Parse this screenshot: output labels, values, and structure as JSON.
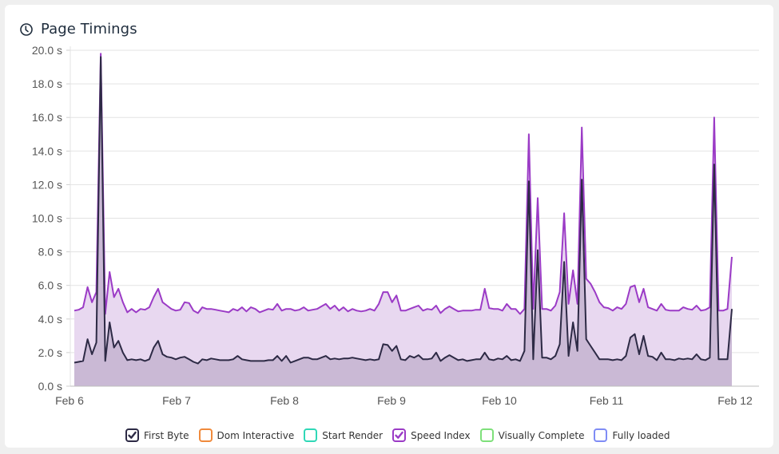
{
  "panel": {
    "title": "Page Timings",
    "icon": "clock-icon"
  },
  "legend": [
    {
      "label": "First Byte",
      "color": "#2d2a45",
      "checked": true
    },
    {
      "label": "Dom Interactive",
      "color": "#f08a3c",
      "checked": false
    },
    {
      "label": "Start Render",
      "color": "#2fd8b7",
      "checked": false
    },
    {
      "label": "Speed Index",
      "color": "#9b3bc6",
      "checked": true
    },
    {
      "label": "Visually Complete",
      "color": "#7ee07a",
      "checked": false
    },
    {
      "label": "Fully loaded",
      "color": "#7f8cf5",
      "checked": false
    }
  ],
  "chart_data": {
    "type": "area",
    "title": "Page Timings",
    "xlabel": "",
    "ylabel": "",
    "ylim": [
      0,
      20
    ],
    "yticks": [
      "0.0 s",
      "2.0 s",
      "4.0 s",
      "6.0 s",
      "8.0 s",
      "10.0 s",
      "12.0 s",
      "14.0 s",
      "16.0 s",
      "18.0 s",
      "20.0 s"
    ],
    "xticks": [
      "Feb 6",
      "Feb 7",
      "Feb 8",
      "Feb 9",
      "Feb 10",
      "Feb 11",
      "Feb 12"
    ],
    "xrange_days": [
      0,
      6
    ],
    "x_start_day": 0.045,
    "x_end_day": 6.0,
    "grid": true,
    "legend_position": "bottom",
    "series": [
      {
        "name": "Speed Index",
        "color": "#9b3bc6",
        "fill": "#e8d8f0",
        "values": [
          4.5,
          4.55,
          4.7,
          5.9,
          5.0,
          5.6,
          19.8,
          4.3,
          6.8,
          5.3,
          5.8,
          5.0,
          4.4,
          4.6,
          4.4,
          4.6,
          4.55,
          4.7,
          5.3,
          5.8,
          5.0,
          4.8,
          4.6,
          4.5,
          4.55,
          5.0,
          4.95,
          4.5,
          4.35,
          4.7,
          4.6,
          4.6,
          4.55,
          4.5,
          4.45,
          4.4,
          4.6,
          4.5,
          4.7,
          4.45,
          4.7,
          4.6,
          4.4,
          4.5,
          4.6,
          4.55,
          4.9,
          4.5,
          4.6,
          4.6,
          4.5,
          4.55,
          4.7,
          4.5,
          4.55,
          4.6,
          4.75,
          4.9,
          4.6,
          4.8,
          4.5,
          4.7,
          4.45,
          4.6,
          4.5,
          4.45,
          4.5,
          4.6,
          4.5,
          4.9,
          5.6,
          5.6,
          5.0,
          5.4,
          4.5,
          4.5,
          4.6,
          4.7,
          4.8,
          4.5,
          4.6,
          4.55,
          4.8,
          4.35,
          4.6,
          4.75,
          4.6,
          4.45,
          4.5,
          4.5,
          4.5,
          4.55,
          4.55,
          5.8,
          4.65,
          4.6,
          4.6,
          4.5,
          4.9,
          4.6,
          4.6,
          4.3,
          4.6,
          15.0,
          4.6,
          11.2,
          4.6,
          4.6,
          4.5,
          4.8,
          5.6,
          10.3,
          4.9,
          6.9,
          4.9,
          15.4,
          6.4,
          6.1,
          5.6,
          5.0,
          4.7,
          4.65,
          4.5,
          4.7,
          4.6,
          4.9,
          5.9,
          6.0,
          5.0,
          5.8,
          4.7,
          4.6,
          4.5,
          4.9,
          4.55,
          4.5,
          4.5,
          4.5,
          4.7,
          4.6,
          4.55,
          4.8,
          4.5,
          4.55,
          4.7,
          16.0,
          4.5,
          4.5,
          4.6,
          7.7
        ]
      },
      {
        "name": "First Byte",
        "color": "#2d2a45",
        "fill": "#c6b6d2",
        "values": [
          1.4,
          1.45,
          1.5,
          2.8,
          1.9,
          2.6,
          19.6,
          1.5,
          3.8,
          2.3,
          2.7,
          2.0,
          1.55,
          1.6,
          1.55,
          1.6,
          1.5,
          1.6,
          2.3,
          2.7,
          1.9,
          1.75,
          1.7,
          1.6,
          1.7,
          1.75,
          1.6,
          1.45,
          1.35,
          1.6,
          1.55,
          1.65,
          1.6,
          1.55,
          1.55,
          1.55,
          1.6,
          1.8,
          1.6,
          1.55,
          1.5,
          1.5,
          1.5,
          1.5,
          1.55,
          1.55,
          1.8,
          1.5,
          1.8,
          1.4,
          1.5,
          1.6,
          1.7,
          1.7,
          1.6,
          1.6,
          1.7,
          1.8,
          1.6,
          1.65,
          1.6,
          1.65,
          1.65,
          1.7,
          1.65,
          1.6,
          1.55,
          1.6,
          1.55,
          1.6,
          2.5,
          2.45,
          2.1,
          2.4,
          1.6,
          1.55,
          1.8,
          1.7,
          1.85,
          1.6,
          1.6,
          1.65,
          2.0,
          1.5,
          1.7,
          1.85,
          1.7,
          1.55,
          1.6,
          1.5,
          1.55,
          1.6,
          1.6,
          2.0,
          1.6,
          1.55,
          1.65,
          1.6,
          1.8,
          1.55,
          1.6,
          1.5,
          2.1,
          12.2,
          1.6,
          8.1,
          1.7,
          1.7,
          1.6,
          1.8,
          2.5,
          7.4,
          1.8,
          3.8,
          2.1,
          12.3,
          2.8,
          2.4,
          2.0,
          1.6,
          1.6,
          1.6,
          1.55,
          1.6,
          1.55,
          1.8,
          2.9,
          3.1,
          1.9,
          3.0,
          1.8,
          1.75,
          1.55,
          2.0,
          1.6,
          1.6,
          1.55,
          1.65,
          1.6,
          1.65,
          1.6,
          1.9,
          1.6,
          1.55,
          1.7,
          13.2,
          1.6,
          1.6,
          1.6,
          4.6
        ]
      }
    ]
  }
}
